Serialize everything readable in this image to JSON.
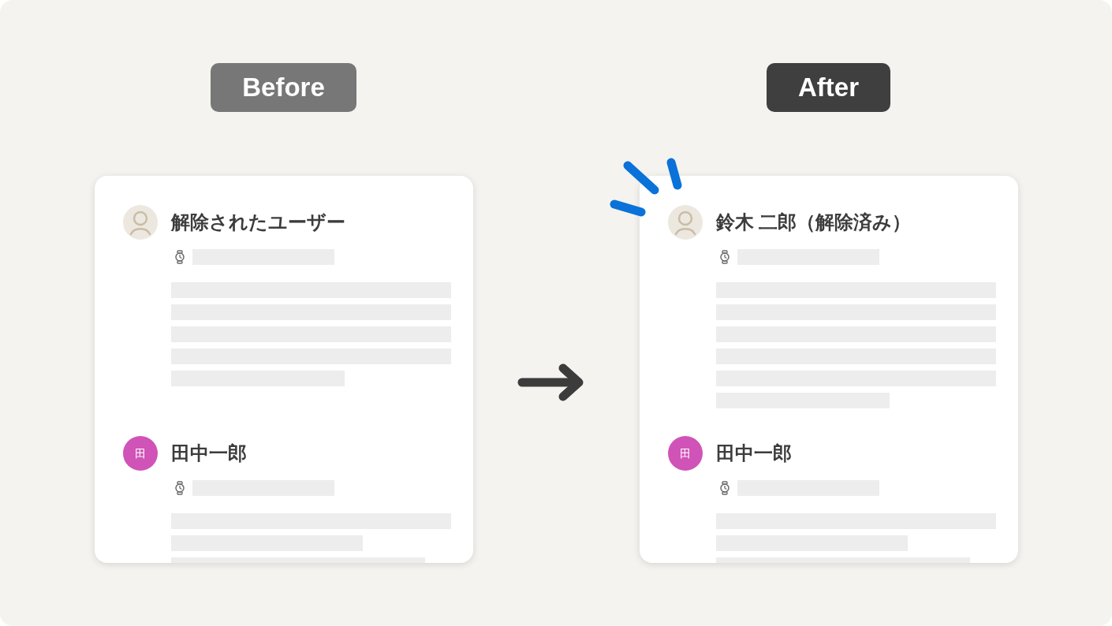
{
  "panels": [
    {
      "label": "Before",
      "highlighted": false,
      "entries": [
        {
          "avatar": {
            "kind": "deleted"
          },
          "name": "解除されたユーザー"
        },
        {
          "avatar": {
            "kind": "initial",
            "text": "田",
            "color": "#d053b8"
          },
          "name": "田中一郎"
        }
      ]
    },
    {
      "label": "After",
      "highlighted": true,
      "entries": [
        {
          "avatar": {
            "kind": "deleted"
          },
          "name": "鈴木 二郎（解除済み）"
        },
        {
          "avatar": {
            "kind": "initial",
            "text": "田",
            "color": "#d053b8"
          },
          "name": "田中一郎"
        }
      ]
    }
  ]
}
